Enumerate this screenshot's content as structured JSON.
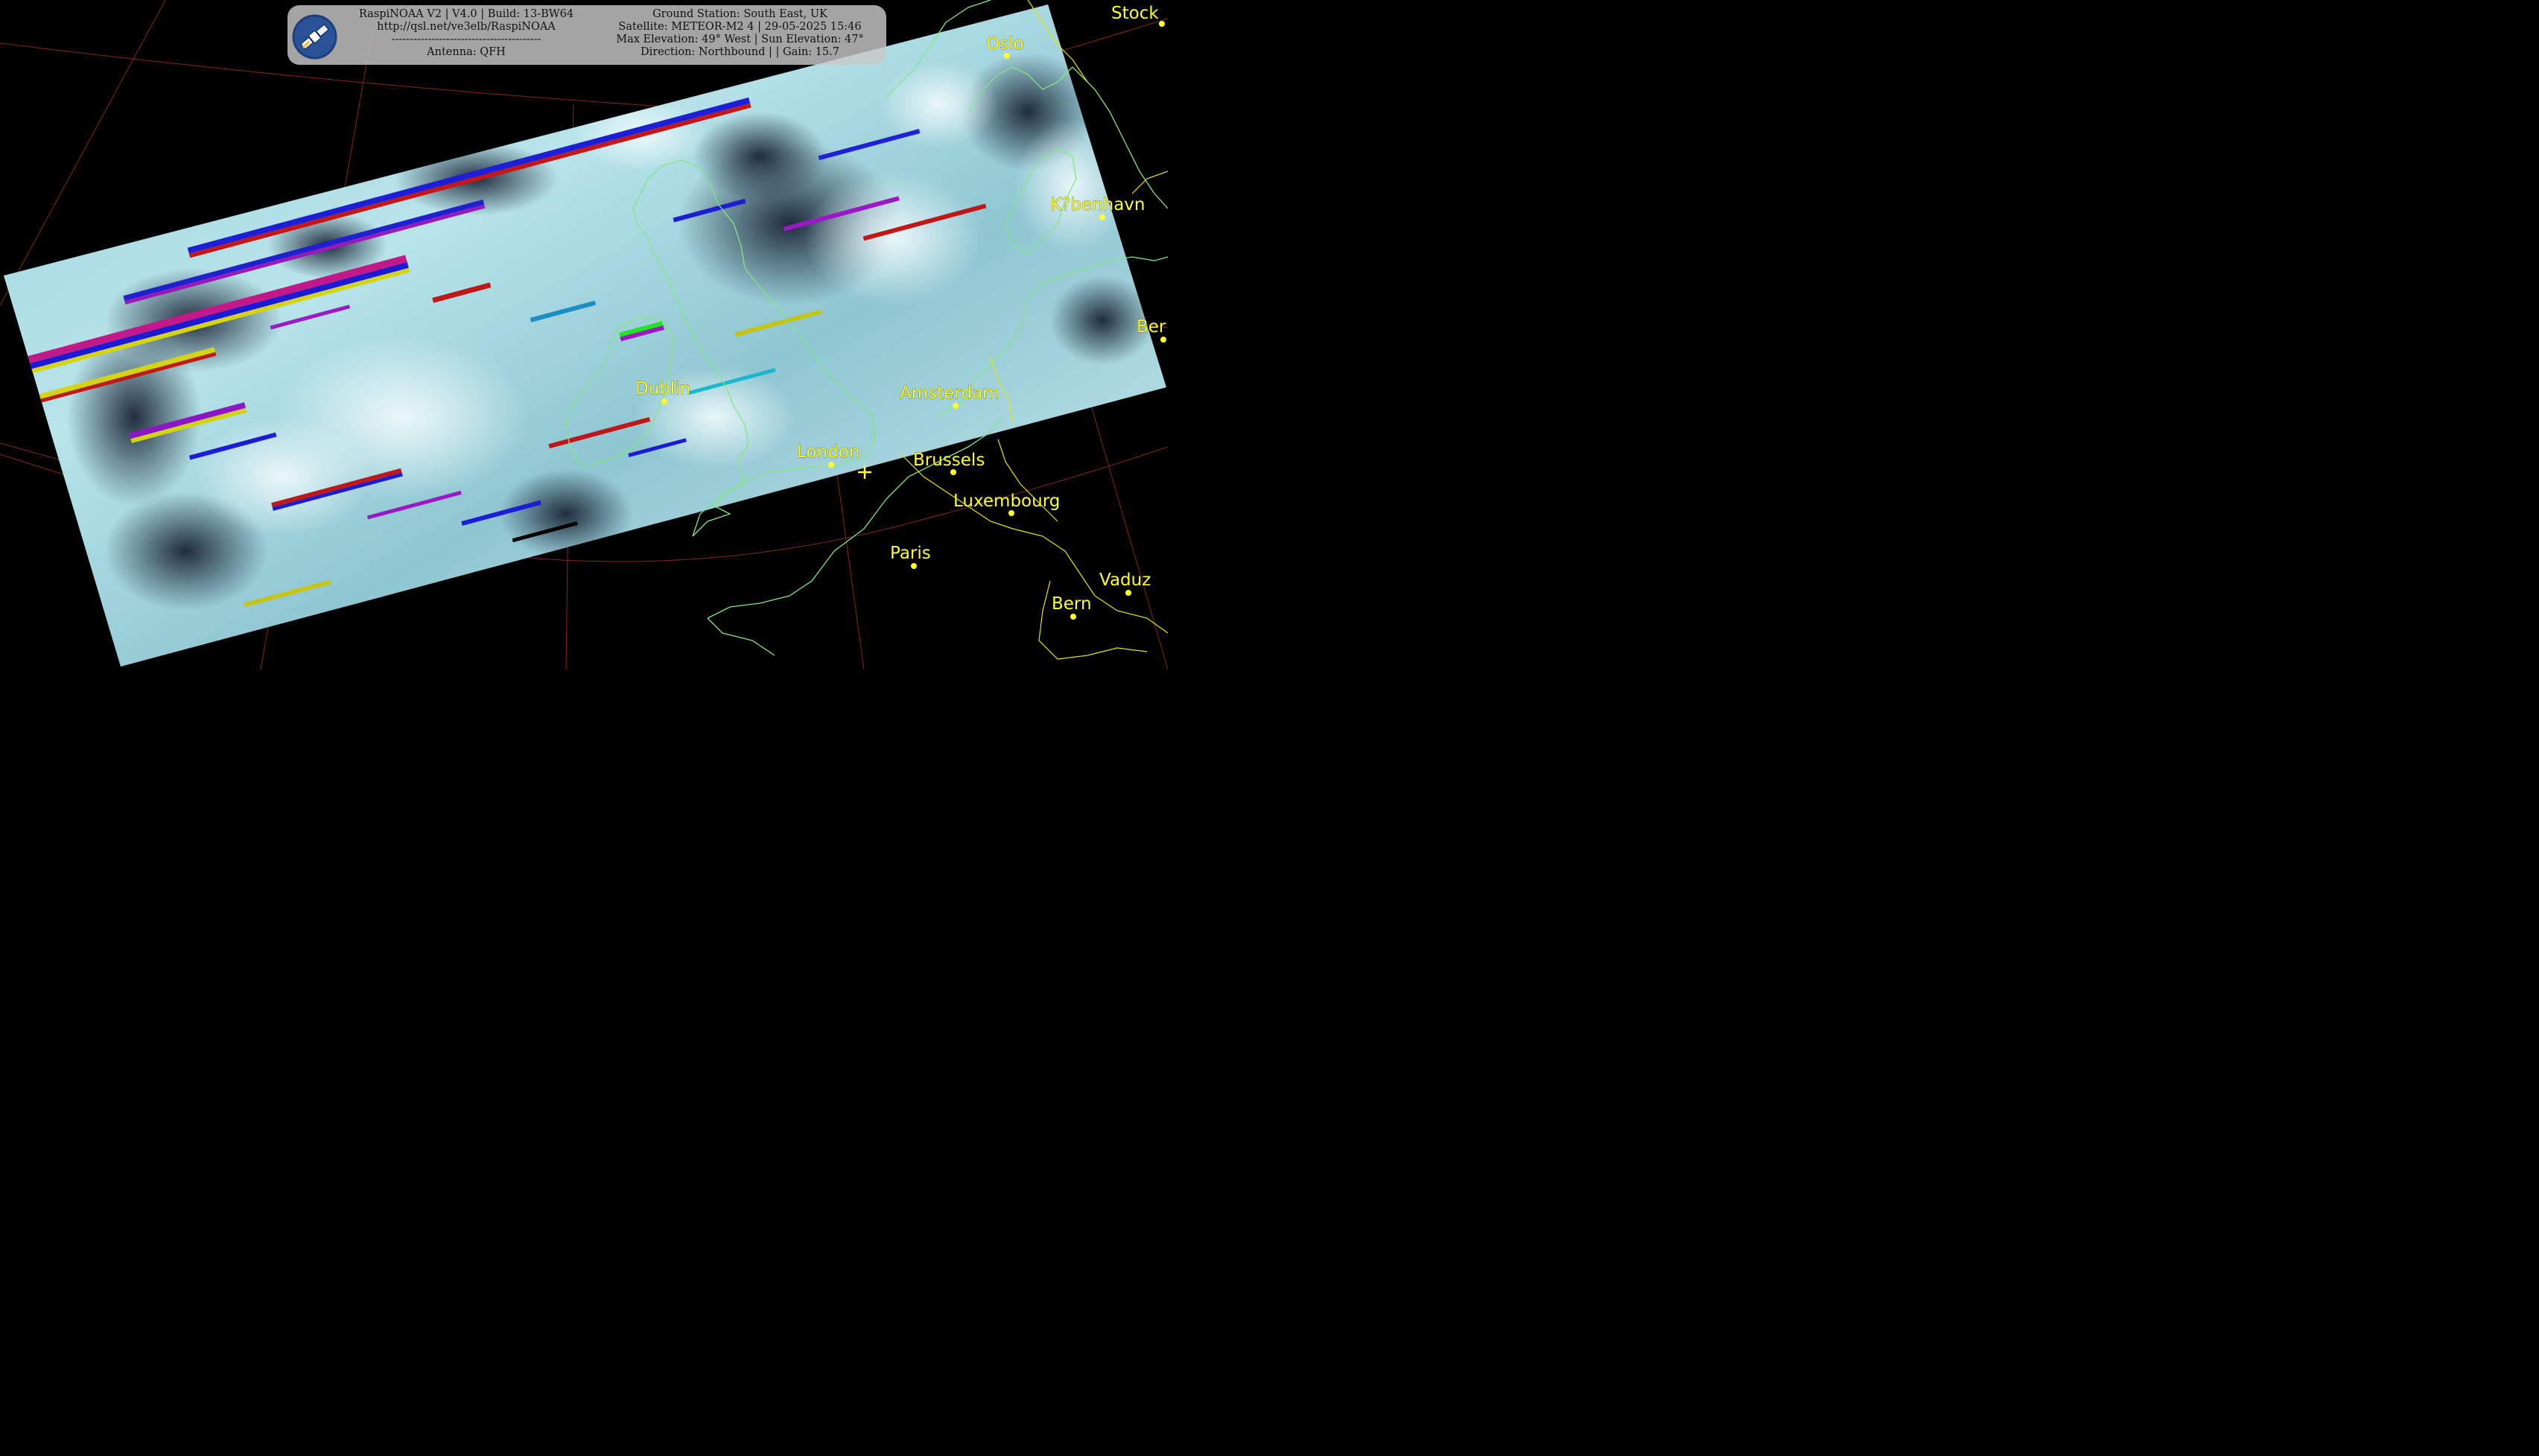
{
  "header": {
    "left_lines": [
      "RaspiNOAA V2 | V4.0 | Build: 13-BW64",
      "http://qsl.net/ve3elb/RaspiNOAA",
      "-----------------------------------------",
      "Antenna: QFH"
    ],
    "right_lines": [
      "Ground Station: South East, UK",
      "Satellite: METEOR-M2 4 | 29-05-2025 15:46",
      "Max Elevation: 49° West | Sun Elevation: 47°",
      "Direction: Northbound | | Gain: 15.7"
    ]
  },
  "cities": {
    "stockholm": "Stock",
    "oslo": "Oslo",
    "kobenhavn": "K?benhavn",
    "berlin": "Ber",
    "dublin": "Dublin",
    "amsterdam": "Amsterdam",
    "london": "London",
    "brussels": "Brussels",
    "luxembourg": "Luxembourg",
    "paris": "Paris",
    "vaduz": "Vaduz",
    "bern": "Bern"
  },
  "colors": {
    "background": "#000000",
    "label": "#ffff2a",
    "coastline": "#7fe87f",
    "border": "#e6e600",
    "graticule": "#8a2323"
  }
}
